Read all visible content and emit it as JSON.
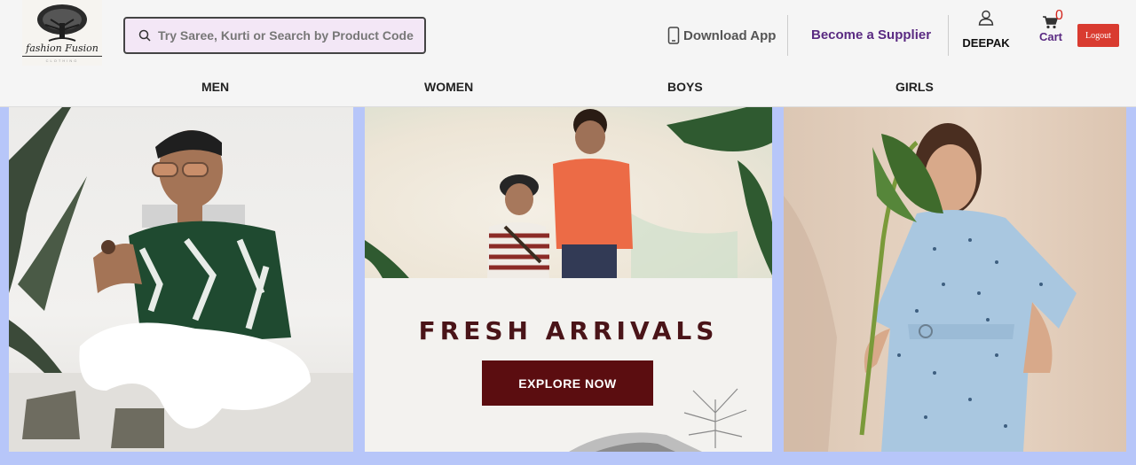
{
  "header": {
    "logo_text": "fashion Fusion",
    "logo_sub": "CLOTHING",
    "search_placeholder": "Try Saree, Kurti or Search by Product Code",
    "download_app": "Download App",
    "become_supplier": "Become a Supplier",
    "user_name": "DEEPAK",
    "cart_label": "Cart",
    "cart_count": "0",
    "logout_label": "Logout"
  },
  "nav": {
    "items": [
      {
        "label": "MEN"
      },
      {
        "label": "WOMEN"
      },
      {
        "label": "BOYS"
      },
      {
        "label": "GIRLS"
      }
    ]
  },
  "banner": {
    "headline": "FRESH ARRIVALS",
    "cta_label": "EXPLORE NOW"
  },
  "colors": {
    "supplier": "#5a2a82",
    "logout_bg": "#d93b30",
    "cta_bg": "#5b0d10",
    "banner_bg": "#b7c6f9",
    "search_bg": "#f3e7f6"
  }
}
